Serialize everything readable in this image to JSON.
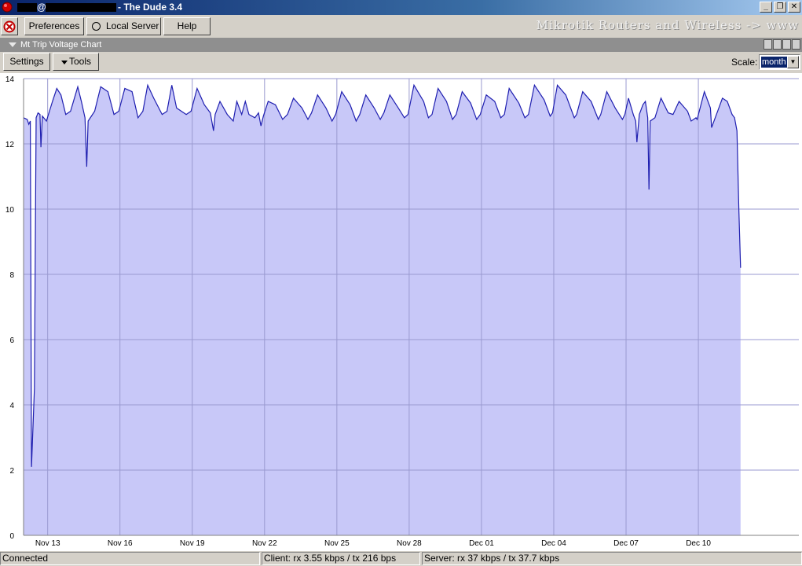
{
  "window": {
    "title_at": "@",
    "title": "- The Dude 3.4",
    "buttons": [
      "_",
      "❐",
      "✕"
    ]
  },
  "toolbar": {
    "preferences_label": "Preferences",
    "local_server_label": "Local Server",
    "help_label": "Help",
    "brand": "Mikrotik Routers and Wireless -> www"
  },
  "panel": {
    "title": "Mt Trip Voltage Chart"
  },
  "subtoolbar": {
    "settings_label": "Settings",
    "tools_label": "Tools",
    "scale_label": "Scale:",
    "scale_value": "month"
  },
  "status": {
    "connection": "Connected",
    "client": "Client: rx 3.55 kbps / tx 216 bps",
    "server": "Server: rx 37 kbps / tx 37.7 kbps"
  },
  "colors": {
    "line": "#1f1fb0",
    "fill": "#c8c8f8",
    "grid": "#9a9ad0"
  },
  "chart_data": {
    "type": "area",
    "ylim": [
      0,
      14
    ],
    "yticks": [
      0,
      2,
      4,
      6,
      8,
      10,
      12,
      14
    ],
    "xlim": [
      12.0,
      44.17
    ],
    "xticks": [
      {
        "x": 13,
        "label": "Nov 13"
      },
      {
        "x": 16,
        "label": "Nov 16"
      },
      {
        "x": 19,
        "label": "Nov 19"
      },
      {
        "x": 22,
        "label": "Nov 22"
      },
      {
        "x": 25,
        "label": "Nov 25"
      },
      {
        "x": 28,
        "label": "Nov 28"
      },
      {
        "x": 31,
        "label": "Dec 01"
      },
      {
        "x": 34,
        "label": "Dec 04"
      },
      {
        "x": 37,
        "label": "Dec 07"
      },
      {
        "x": 40,
        "label": "Dec 10"
      }
    ],
    "grid": true,
    "points": [
      [
        12.0,
        12.8
      ],
      [
        12.15,
        12.75
      ],
      [
        12.22,
        12.6
      ],
      [
        12.28,
        12.7
      ],
      [
        12.33,
        2.1
      ],
      [
        12.45,
        4.5
      ],
      [
        12.52,
        12.8
      ],
      [
        12.6,
        12.95
      ],
      [
        12.68,
        12.9
      ],
      [
        12.72,
        11.9
      ],
      [
        12.78,
        12.85
      ],
      [
        12.95,
        12.7
      ],
      [
        13.2,
        13.3
      ],
      [
        13.38,
        13.7
      ],
      [
        13.55,
        13.5
      ],
      [
        13.75,
        12.9
      ],
      [
        13.95,
        13.0
      ],
      [
        14.25,
        13.75
      ],
      [
        14.4,
        13.3
      ],
      [
        14.55,
        12.8
      ],
      [
        14.62,
        11.3
      ],
      [
        14.68,
        12.7
      ],
      [
        14.95,
        13.0
      ],
      [
        15.2,
        13.75
      ],
      [
        15.5,
        13.6
      ],
      [
        15.75,
        12.9
      ],
      [
        15.95,
        13.0
      ],
      [
        16.2,
        13.7
      ],
      [
        16.5,
        13.6
      ],
      [
        16.75,
        12.8
      ],
      [
        16.95,
        13.0
      ],
      [
        17.15,
        13.8
      ],
      [
        17.4,
        13.4
      ],
      [
        17.75,
        12.9
      ],
      [
        17.95,
        13.0
      ],
      [
        18.15,
        13.8
      ],
      [
        18.35,
        13.1
      ],
      [
        18.75,
        12.9
      ],
      [
        18.95,
        13.0
      ],
      [
        19.2,
        13.7
      ],
      [
        19.5,
        13.2
      ],
      [
        19.75,
        12.95
      ],
      [
        19.88,
        12.4
      ],
      [
        19.95,
        12.9
      ],
      [
        20.15,
        13.3
      ],
      [
        20.45,
        12.9
      ],
      [
        20.7,
        12.7
      ],
      [
        20.85,
        13.3
      ],
      [
        21.05,
        12.9
      ],
      [
        21.2,
        13.3
      ],
      [
        21.35,
        12.9
      ],
      [
        21.6,
        12.8
      ],
      [
        21.75,
        12.95
      ],
      [
        21.85,
        12.55
      ],
      [
        21.95,
        12.85
      ],
      [
        22.15,
        13.3
      ],
      [
        22.45,
        13.2
      ],
      [
        22.75,
        12.75
      ],
      [
        22.95,
        12.9
      ],
      [
        23.2,
        13.4
      ],
      [
        23.55,
        13.1
      ],
      [
        23.8,
        12.75
      ],
      [
        23.95,
        12.95
      ],
      [
        24.2,
        13.5
      ],
      [
        24.55,
        13.1
      ],
      [
        24.8,
        12.7
      ],
      [
        24.95,
        12.9
      ],
      [
        25.2,
        13.6
      ],
      [
        25.55,
        13.2
      ],
      [
        25.8,
        12.7
      ],
      [
        25.95,
        12.9
      ],
      [
        26.2,
        13.5
      ],
      [
        26.55,
        13.1
      ],
      [
        26.8,
        12.75
      ],
      [
        26.95,
        12.95
      ],
      [
        27.2,
        13.5
      ],
      [
        27.55,
        13.1
      ],
      [
        27.8,
        12.8
      ],
      [
        27.95,
        12.9
      ],
      [
        28.2,
        13.8
      ],
      [
        28.6,
        13.3
      ],
      [
        28.8,
        12.8
      ],
      [
        28.95,
        12.9
      ],
      [
        29.2,
        13.7
      ],
      [
        29.55,
        13.3
      ],
      [
        29.8,
        12.75
      ],
      [
        29.95,
        12.9
      ],
      [
        30.2,
        13.6
      ],
      [
        30.55,
        13.25
      ],
      [
        30.8,
        12.75
      ],
      [
        30.95,
        12.9
      ],
      [
        31.2,
        13.5
      ],
      [
        31.55,
        13.3
      ],
      [
        31.8,
        12.8
      ],
      [
        31.95,
        12.9
      ],
      [
        32.15,
        13.7
      ],
      [
        32.55,
        13.25
      ],
      [
        32.8,
        12.8
      ],
      [
        32.95,
        12.9
      ],
      [
        33.2,
        13.8
      ],
      [
        33.6,
        13.35
      ],
      [
        33.85,
        12.85
      ],
      [
        33.95,
        12.95
      ],
      [
        34.15,
        13.8
      ],
      [
        34.5,
        13.5
      ],
      [
        34.85,
        12.8
      ],
      [
        34.95,
        12.9
      ],
      [
        35.2,
        13.6
      ],
      [
        35.55,
        13.3
      ],
      [
        35.85,
        12.75
      ],
      [
        35.95,
        12.9
      ],
      [
        36.2,
        13.6
      ],
      [
        36.55,
        13.1
      ],
      [
        36.85,
        12.75
      ],
      [
        36.95,
        12.9
      ],
      [
        37.1,
        13.4
      ],
      [
        37.3,
        12.9
      ],
      [
        37.4,
        12.7
      ],
      [
        37.45,
        12.05
      ],
      [
        37.55,
        12.9
      ],
      [
        37.7,
        13.2
      ],
      [
        37.8,
        13.3
      ],
      [
        37.9,
        12.8
      ],
      [
        37.95,
        10.6
      ],
      [
        38.0,
        12.7
      ],
      [
        38.2,
        12.8
      ],
      [
        38.45,
        13.4
      ],
      [
        38.75,
        12.95
      ],
      [
        38.95,
        12.9
      ],
      [
        39.2,
        13.3
      ],
      [
        39.55,
        13.0
      ],
      [
        39.7,
        12.7
      ],
      [
        39.9,
        12.8
      ],
      [
        39.95,
        12.75
      ],
      [
        40.25,
        13.6
      ],
      [
        40.5,
        13.1
      ],
      [
        40.55,
        12.5
      ],
      [
        40.7,
        12.8
      ],
      [
        40.85,
        13.1
      ],
      [
        41.0,
        13.4
      ],
      [
        41.2,
        13.3
      ],
      [
        41.4,
        12.9
      ],
      [
        41.5,
        12.8
      ],
      [
        41.6,
        12.4
      ],
      [
        41.68,
        10.0
      ],
      [
        41.75,
        8.2
      ]
    ]
  }
}
